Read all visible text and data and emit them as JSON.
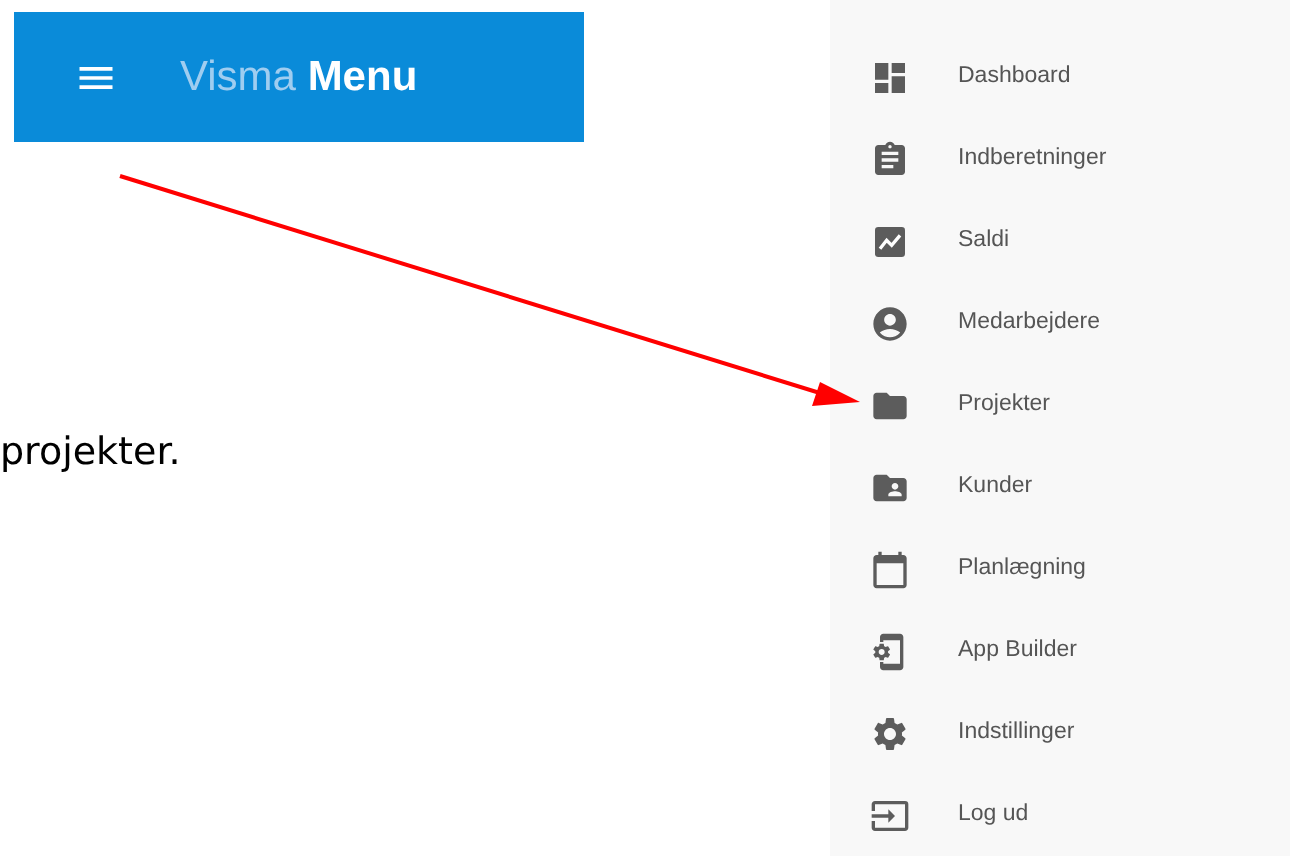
{
  "header": {
    "brand": "Visma",
    "title": "Menu"
  },
  "body_text": "projekter.",
  "menu": {
    "items": [
      {
        "label": "Dashboard"
      },
      {
        "label": "Indberetninger"
      },
      {
        "label": "Saldi"
      },
      {
        "label": "Medarbejdere"
      },
      {
        "label": "Projekter"
      },
      {
        "label": "Kunder"
      },
      {
        "label": "Planlægning"
      },
      {
        "label": "App Builder"
      },
      {
        "label": "Indstillinger"
      },
      {
        "label": "Log ud"
      }
    ]
  }
}
